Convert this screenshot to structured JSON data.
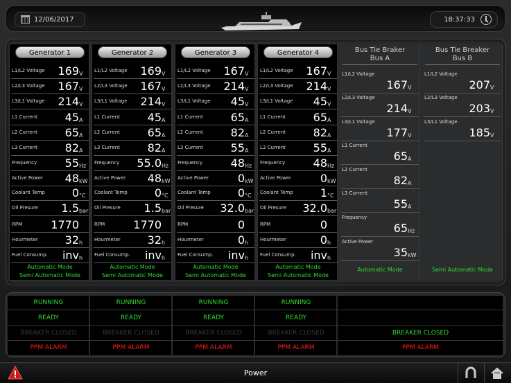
{
  "header": {
    "date": "12/06/2017",
    "time": "18:37:33"
  },
  "generators": [
    {
      "name": "Generator 1",
      "rows": [
        [
          "L1/L2 Voltage",
          "169",
          "V"
        ],
        [
          "L2/L3 Voltage",
          "167",
          "V"
        ],
        [
          "L3/L1 Voltage",
          "214",
          "V"
        ],
        [
          "L1 Current",
          "45",
          "A"
        ],
        [
          "L2 Current",
          "65",
          "A"
        ],
        [
          "L3 Current",
          "82",
          "A"
        ],
        [
          "Frequency",
          "55",
          "Hz"
        ],
        [
          "Active Power",
          "48",
          "kW"
        ],
        [
          "Coolant Temp",
          "0",
          "°C"
        ],
        [
          "Oil Presure",
          "1.5",
          "bar"
        ],
        [
          "RPM",
          "1770",
          ""
        ],
        [
          "Hourmeter",
          "32",
          "h"
        ],
        [
          "Fuel Consump.",
          "inv",
          "h"
        ]
      ],
      "modes": [
        "Automatic Mode",
        "Semi Automatic Mode"
      ]
    },
    {
      "name": "Generator 2",
      "rows": [
        [
          "L1/L2 Voltage",
          "169",
          "V"
        ],
        [
          "L2/L3 Voltage",
          "167",
          "V"
        ],
        [
          "L3/L1 Voltage",
          "214",
          "V"
        ],
        [
          "L1 Current",
          "45",
          "A"
        ],
        [
          "L2 Current",
          "65",
          "A"
        ],
        [
          "L3 Current",
          "82",
          "A"
        ],
        [
          "Frequency",
          "55.0",
          "Hz"
        ],
        [
          "Active Power",
          "48",
          "kW"
        ],
        [
          "Coolant Temp",
          "0",
          "°C"
        ],
        [
          "Oil Presure",
          "1.5",
          "bar"
        ],
        [
          "RPM",
          "1770",
          ""
        ],
        [
          "Hourmeter",
          "32",
          "h"
        ],
        [
          "Fuel Consump.",
          "inv",
          "h"
        ]
      ],
      "modes": [
        "Automatic Mode",
        "Semi Automatic Mode"
      ]
    },
    {
      "name": "Generator 3",
      "rows": [
        [
          "L1/L2 Voltage",
          "167",
          "V"
        ],
        [
          "L2/L3 Voltage",
          "214",
          "V"
        ],
        [
          "L3/L1 Voltage",
          "45",
          "V"
        ],
        [
          "L1 Current",
          "65",
          "A"
        ],
        [
          "L2 Current",
          "82",
          "A"
        ],
        [
          "L3 Current",
          "55",
          "A"
        ],
        [
          "Frequency",
          "48",
          "Hz"
        ],
        [
          "Active Power",
          "0",
          "kW"
        ],
        [
          "Coolant Temp",
          "0",
          "°C"
        ],
        [
          "Oil Presure",
          "32.0",
          "bar"
        ],
        [
          "RPM",
          "0",
          ""
        ],
        [
          "Hourmeter",
          "0",
          "h"
        ],
        [
          "Fuel Consump.",
          "inv",
          "h"
        ]
      ],
      "modes": [
        "Automatic Mode",
        "Semi Automatic Mode"
      ]
    },
    {
      "name": "Generator 4",
      "rows": [
        [
          "L1/L2 Voltage",
          "167",
          "V"
        ],
        [
          "L2/L3 Voltage",
          "214",
          "V"
        ],
        [
          "L3/L1 Voltage",
          "45",
          "V"
        ],
        [
          "L1 Current",
          "65",
          "A"
        ],
        [
          "L2 Current",
          "82",
          "A"
        ],
        [
          "L3 Current",
          "55",
          "A"
        ],
        [
          "Frequency",
          "48",
          "Hz"
        ],
        [
          "Active Power",
          "0",
          "kW"
        ],
        [
          "Coolant Temp",
          "1",
          "°C"
        ],
        [
          "Oil Presure",
          "32.0",
          "bar"
        ],
        [
          "RPM",
          "0",
          ""
        ],
        [
          "Hourmeter",
          "0",
          "h"
        ],
        [
          "Fuel Consump.",
          "inv",
          "h"
        ]
      ],
      "modes": [
        "Automatic Mode",
        "Semi Automatic Mode"
      ]
    }
  ],
  "bus_a": {
    "title1": "Bus Tie Braker",
    "title2": "Bus A",
    "rows": [
      [
        "L1/L2 Voltage",
        "167",
        "V"
      ],
      [
        "L2/L3 Voltage",
        "214",
        "V"
      ],
      [
        "L3/L1 Voltage",
        "177",
        "V"
      ],
      [
        "L1 Current",
        "65",
        "A"
      ],
      [
        "L2 Current",
        "82",
        "A"
      ],
      [
        "L3 Current",
        "55",
        "A"
      ],
      [
        "Frequency",
        "65",
        "Hz"
      ],
      [
        "Active Power",
        "35",
        "kW"
      ]
    ],
    "mode": "Automatic Mode"
  },
  "bus_b": {
    "title1": "Bus Tie Breaker",
    "title2": "Bus B",
    "rows": [
      [
        "L1/L2 Voltage",
        "207",
        "V"
      ],
      [
        "L2/L3 Voltage",
        "203",
        "V"
      ],
      [
        "L3/L1 Voltage",
        "185",
        "V"
      ]
    ],
    "mode": "Semi Automatic Mode"
  },
  "status": {
    "running": "RUNNING",
    "ready": "READY",
    "breaker": "BREAKER CLOSED",
    "alarm": "PPM ALARM"
  },
  "footer": {
    "title": "Power"
  },
  "colors": {
    "green": "#2fdc2f",
    "red": "#ff1a1a",
    "dim": "#3b3b3b"
  }
}
